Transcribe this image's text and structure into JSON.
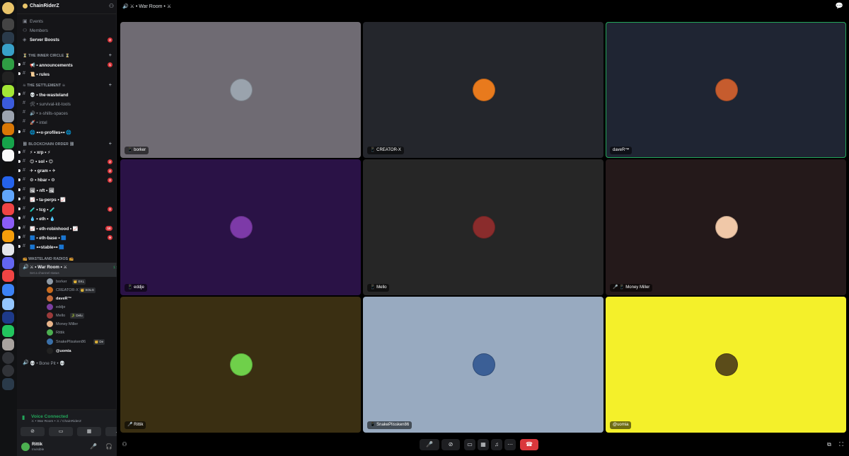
{
  "server": {
    "name": "ChainRiderZ"
  },
  "top_links": [
    {
      "label": "Events",
      "icon": "calendar-icon"
    },
    {
      "label": "Members",
      "icon": "members-icon"
    },
    {
      "label": "Server Boosts",
      "icon": "boost-icon",
      "count": "2"
    }
  ],
  "categories": [
    {
      "label": "⏳ THE INNER CIRCLE ⏳"
    },
    {
      "label": "☠ THE SETTLEMENT ☠"
    },
    {
      "label": "⛓ BLOCKCHAIN ORDER ⛓"
    },
    {
      "label": "📻 WASTELAND RADIOS 📻"
    }
  ],
  "channels": [
    {
      "label": "📢 • announcements",
      "count": "1",
      "bold": true
    },
    {
      "label": "📜 • rules",
      "bold": true
    },
    {
      "label": "💀 • the-wasteland",
      "bold": true
    },
    {
      "label": "🛠 • survival-kit-tools"
    },
    {
      "label": "🔊 • x-shills-spaces"
    },
    {
      "label": "🚀 • intel"
    },
    {
      "label": "🌐 ⊷x-profiles⊶ 🌐",
      "bold": true
    },
    {
      "label": "⚡ • xrp • ⚡",
      "bold": true
    },
    {
      "label": "😊 • sol • 😊",
      "count": "2",
      "bold": true
    },
    {
      "label": "✈ • gram • ✈",
      "count": "2",
      "bold": true
    },
    {
      "label": "⚙ • hbar • ⚙",
      "count": "2",
      "bold": true
    },
    {
      "label": "🖼 • nft • 🖼",
      "bold": true
    },
    {
      "label": "📈 • ta-perps • 📈",
      "bold": true
    },
    {
      "label": "🧪 • tcg • 🧪",
      "count": "2",
      "bold": true
    },
    {
      "label": "💧 • eth • 💧",
      "bold": true
    },
    {
      "label": "📈 • eth-robinhood • 📈",
      "count": "10",
      "bold": true
    },
    {
      "label": "🟦 • eth-base • 🟦",
      "count": "9",
      "bold": true
    },
    {
      "label": "🟦 ⊷stable⊶ 🟦",
      "bold": true
    }
  ],
  "voice": {
    "channel": "⚔ • War Room • ⚔",
    "timer": "1:11:04",
    "status_hint": "Set a channel status",
    "second_channel": "💀 • Bone Pit • 💀"
  },
  "members": [
    {
      "name": "borker",
      "tag": "👑 EKL",
      "color": "#8e9aa6"
    },
    {
      "name": "CREATOR-X",
      "tag": "👑 SOLG",
      "color": "#c96b1e"
    },
    {
      "name": "daveR™",
      "color": "#c46a3a",
      "bold": true
    },
    {
      "name": "eddje",
      "color": "#7b3fa0"
    },
    {
      "name": "Mello",
      "tag": "🐊 Delu",
      "color": "#9b3a3a"
    },
    {
      "name": "Money Miller",
      "color": "#e8b48a",
      "muted": true
    },
    {
      "name": "Rittik",
      "color": "#4caf50",
      "muted": true
    },
    {
      "name": "SnakePlissken86",
      "tag": "👑 De",
      "color": "#3a6fa8"
    },
    {
      "name": "@uomia",
      "color": "#222",
      "bold": true
    }
  ],
  "voice_panel": {
    "title": "Voice Connected",
    "sub": "⚔ • War Room • ⚔ / ChainRiderZ"
  },
  "user": {
    "name": "Rittik",
    "status": "Invisible"
  },
  "header": {
    "title": "⚔ • War Room • ⚔"
  },
  "tiles": [
    {
      "name": "borker",
      "bg": "#6f6b73",
      "avatar": "#9aa3ad",
      "prefix": "📱"
    },
    {
      "name": "CREATOR-X",
      "bg": "#24262c",
      "avatar": "#e87a1d",
      "prefix": "📱"
    },
    {
      "name": "daveR™",
      "bg": "#1f2533",
      "avatar": "#c65c2e",
      "prefix": ""
    },
    {
      "name": "eddje",
      "bg": "#2a1246",
      "avatar": "#7d3aa8",
      "prefix": "📱"
    },
    {
      "name": "Mello",
      "bg": "#262626",
      "avatar": "#8a2c2c",
      "prefix": "📱"
    },
    {
      "name": "Money Miller",
      "bg": "#24191a",
      "avatar": "#f0c8a8",
      "prefix": "🎤 📱"
    },
    {
      "name": "Rittik",
      "bg": "#3a2f12",
      "avatar": "#6fd04a",
      "prefix": "🎤"
    },
    {
      "name": "SnakePlissken86",
      "bg": "#98aac0",
      "avatar": "#3b5f96",
      "prefix": "📱"
    },
    {
      "name": "@uomia",
      "bg": "#f4f02a",
      "avatar": "#5b4c1a",
      "prefix": ""
    }
  ],
  "colors": {
    "speaking_ring": "#23a55a",
    "leave": "#da373c"
  }
}
